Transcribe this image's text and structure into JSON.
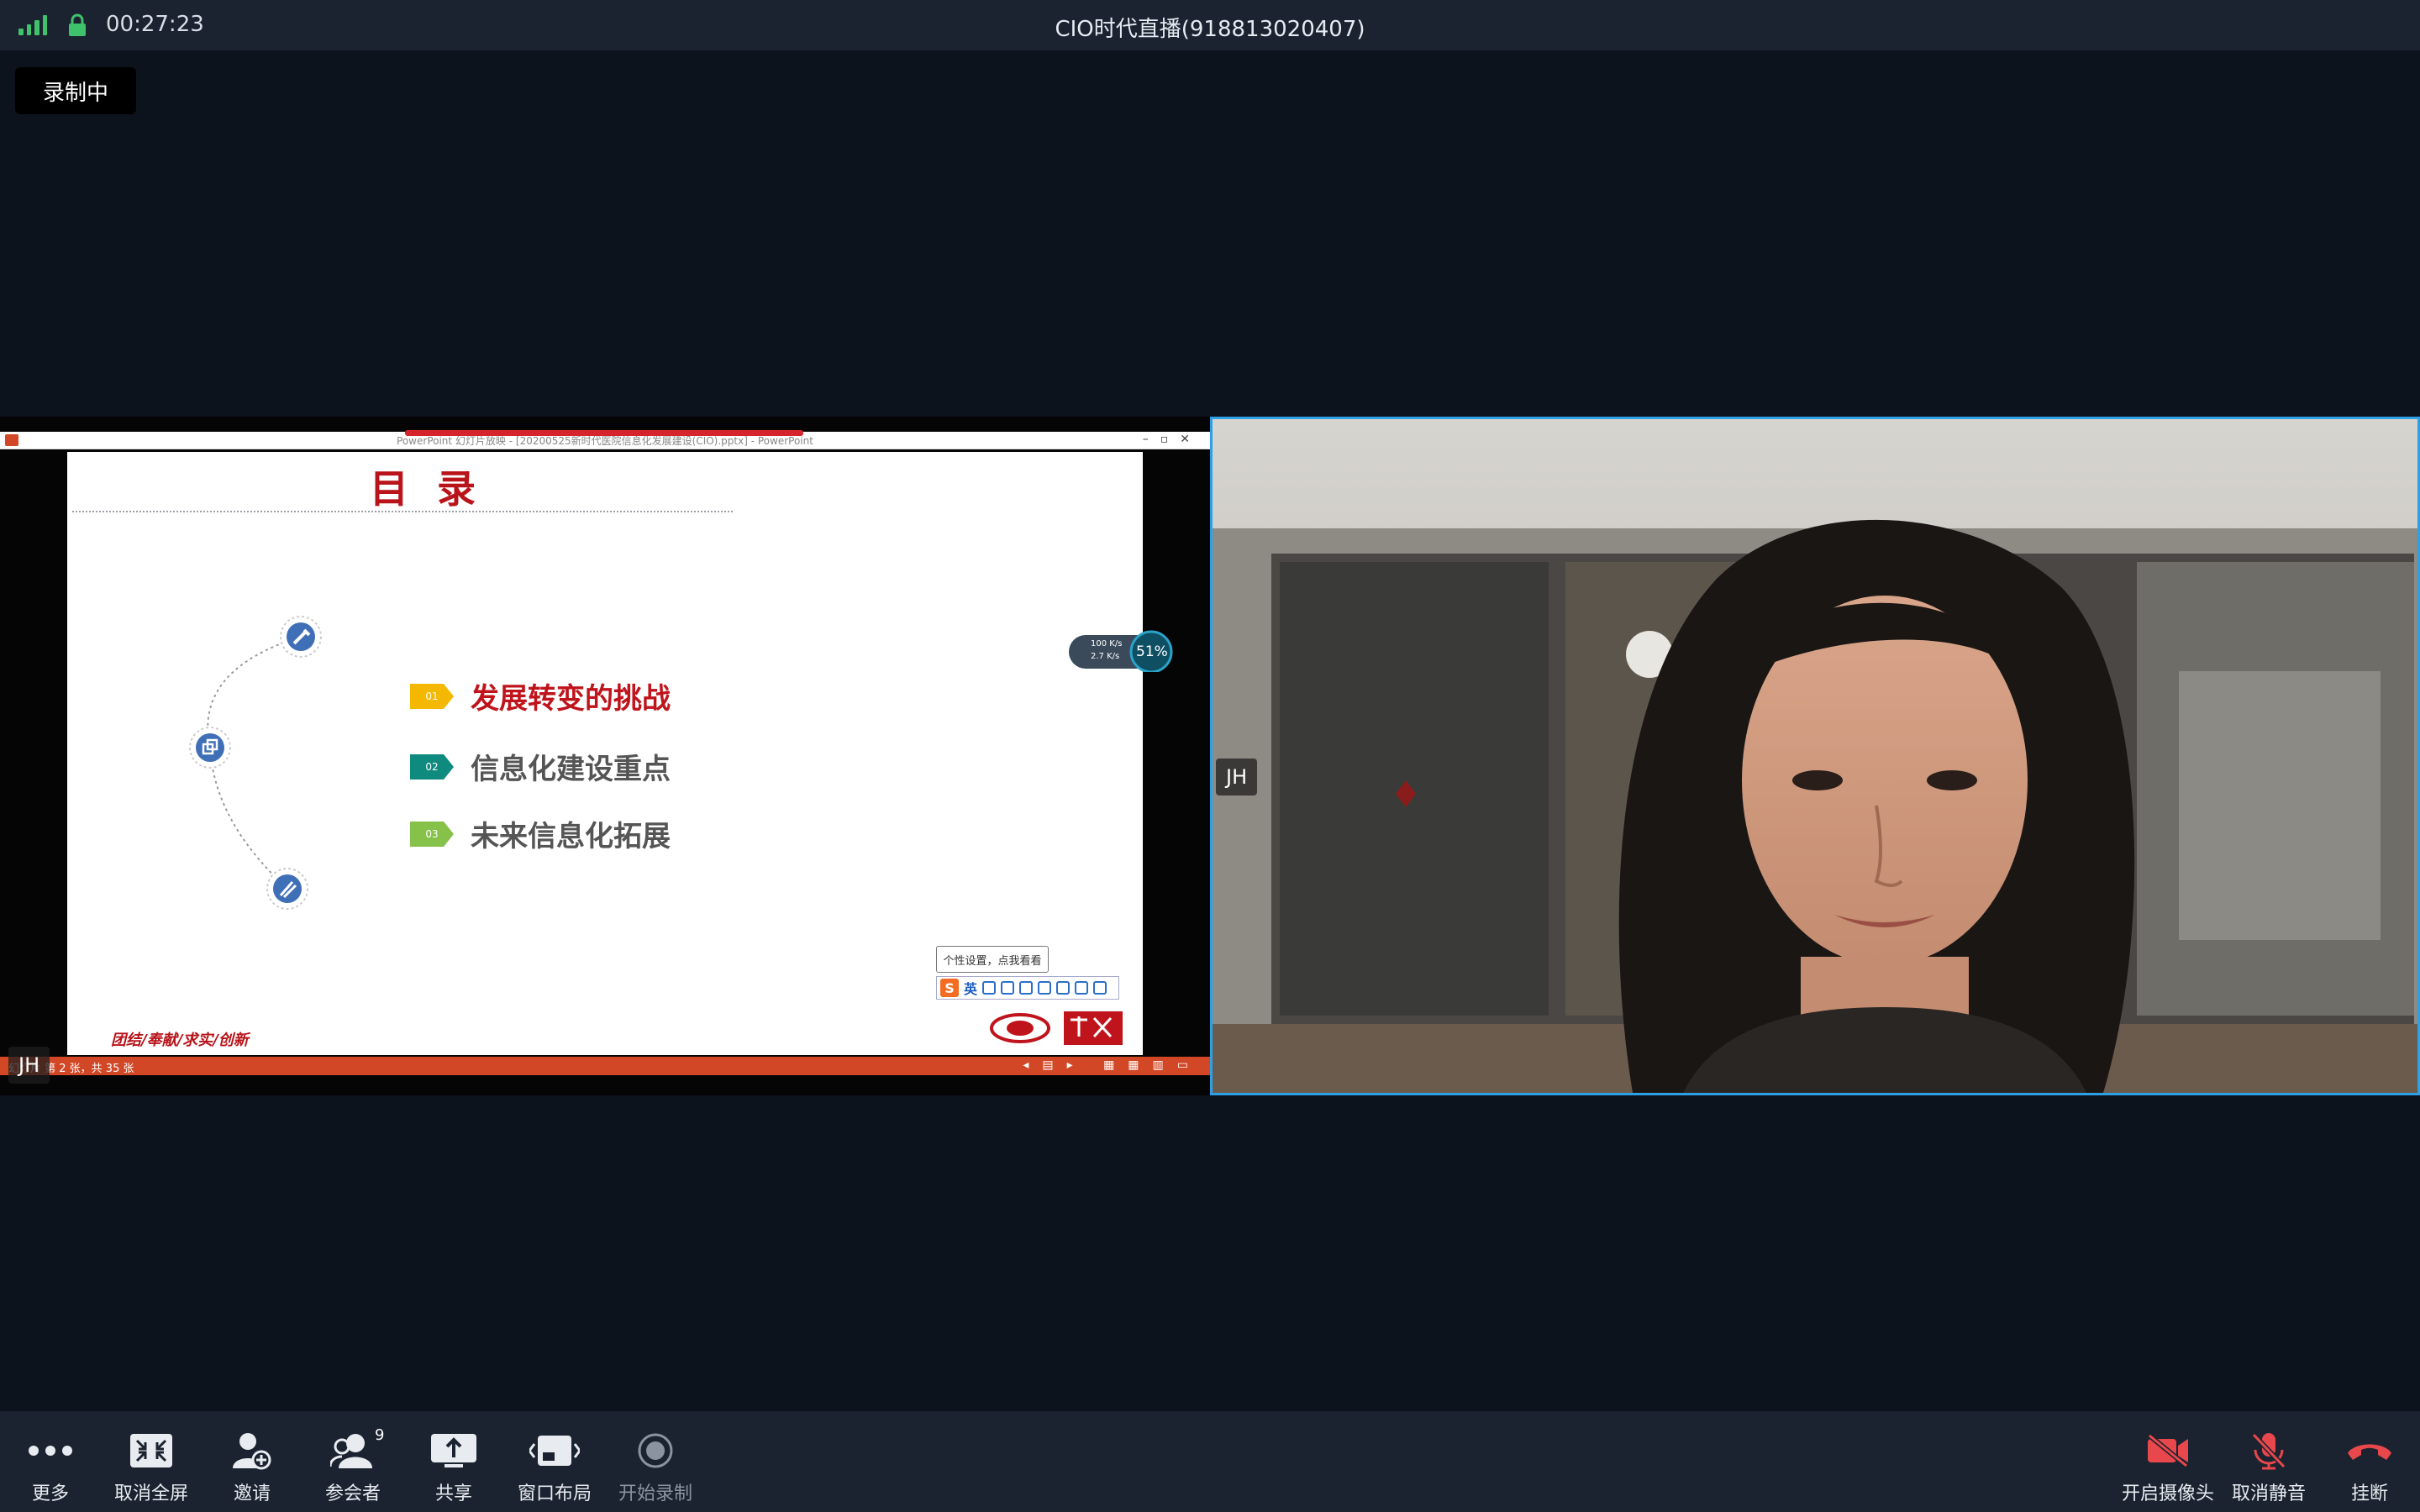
{
  "top_bar": {
    "timer": "00:27:23",
    "title": "CIO时代直播(918813020407)"
  },
  "recording_badge": "录制中",
  "shared_screen": {
    "window_title": "PowerPoint 幻灯片放映 - [20200525新时代医院信息化发展建设(CIO).pptx] - PowerPoint",
    "slide_title": "目录",
    "items": [
      {
        "num": "01",
        "text": "发展转变的挑战",
        "tag_color": "#f5b800",
        "text_color": "#c0141c"
      },
      {
        "num": "02",
        "text": "信息化建设重点",
        "tag_color": "#0f8a7e",
        "text_color": "#555555"
      },
      {
        "num": "03",
        "text": "未来信息化拓展",
        "tag_color": "#86c14a",
        "text_color": "#555555"
      }
    ],
    "motto": "团结/奉献/求实/创新",
    "status_text": "幻灯片 第 2 张，共 35 张",
    "net_widget": {
      "up": "100 K/s",
      "down": "2.7 K/s",
      "percent": "51%"
    },
    "ime_tooltip": "个性设置，点我看看",
    "ime_lang": "英",
    "participant_name": "JH"
  },
  "video": {
    "participant_name": "JH"
  },
  "toolbar": {
    "left": [
      {
        "label": "更多",
        "icon": "more-icon"
      },
      {
        "label": "取消全屏",
        "icon": "exit-fullscreen-icon"
      },
      {
        "label": "邀请",
        "icon": "invite-icon"
      },
      {
        "label": "参会者",
        "icon": "participants-icon",
        "badge": "9"
      },
      {
        "label": "共享",
        "icon": "share-icon"
      },
      {
        "label": "窗口布局",
        "icon": "layout-icon"
      },
      {
        "label": "开始录制",
        "icon": "record-icon",
        "disabled": true
      }
    ],
    "right": [
      {
        "label": "开启摄像头",
        "icon": "camera-off-icon"
      },
      {
        "label": "取消静音",
        "icon": "mic-muted-icon"
      },
      {
        "label": "挂断",
        "icon": "hangup-icon"
      }
    ]
  },
  "colors": {
    "background": "#0d131c",
    "bar": "#1b2330",
    "active_speaker_border": "#2ea0e6",
    "danger": "#e8474c",
    "signal": "#3ec26b"
  }
}
